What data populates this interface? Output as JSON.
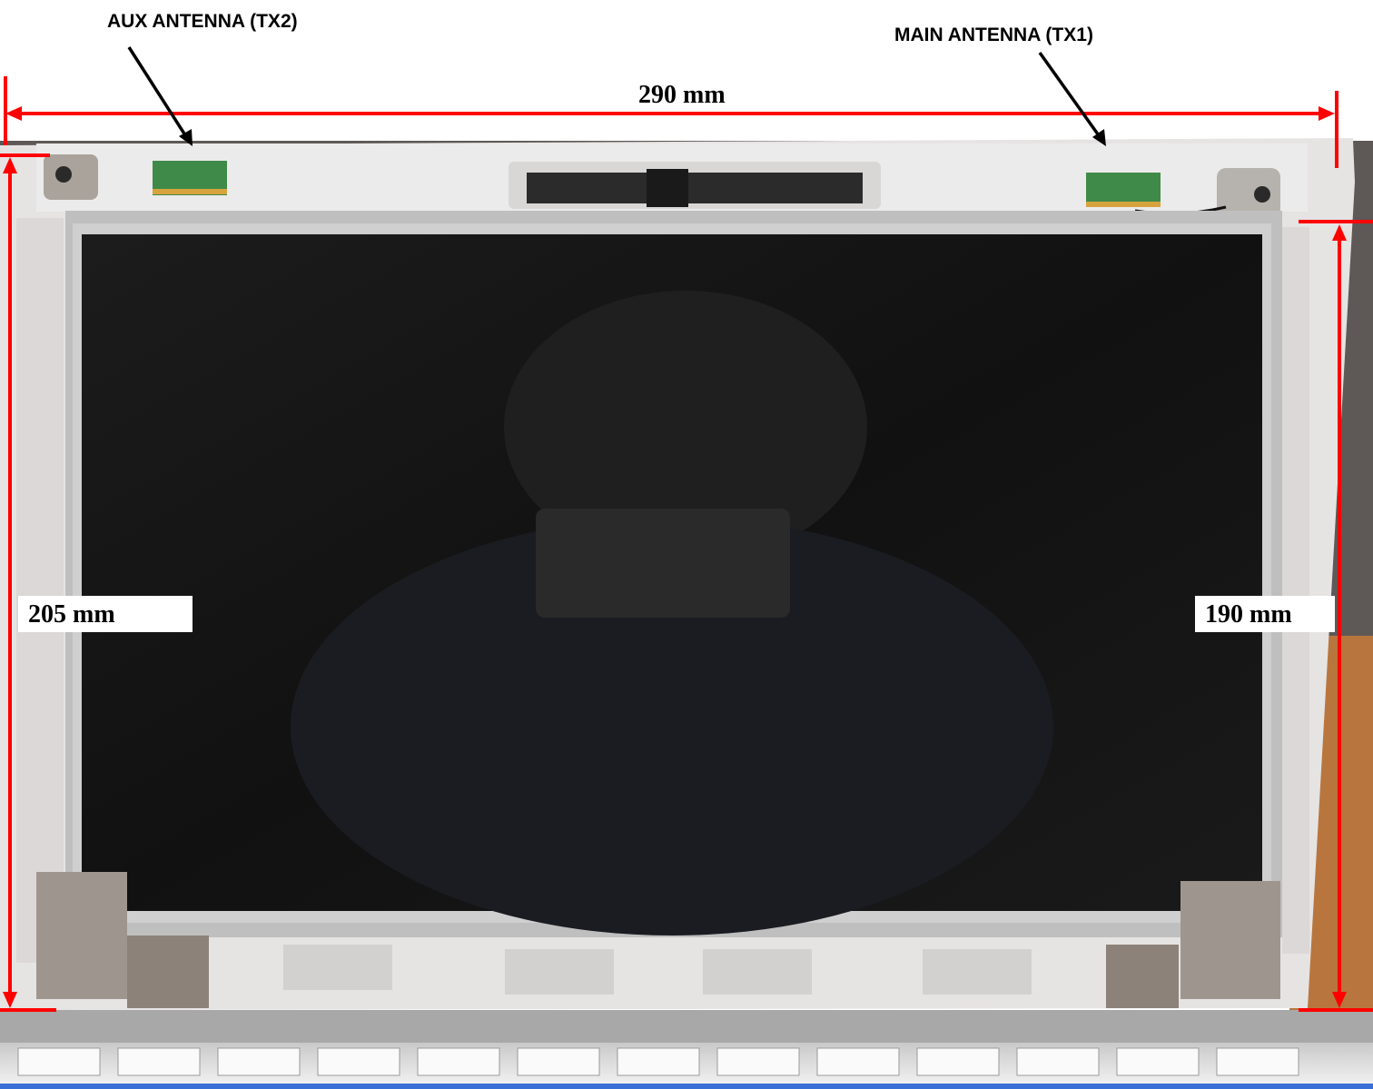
{
  "labels": {
    "aux_antenna": "AUX ANTENNA (TX2)",
    "main_antenna": "MAIN ANTENNA (TX1)",
    "width_dim": "290 mm",
    "left_height_dim": "205 mm",
    "right_height_dim": "190 mm"
  },
  "colors": {
    "dimension_line": "#ff0000",
    "leader_line": "#000000",
    "bezel": "#e6e3e3",
    "panel_frame": "#bfbfbf",
    "screen": "#141414",
    "table": "#b8763e",
    "bottom_rule": "#3b6fd8"
  }
}
